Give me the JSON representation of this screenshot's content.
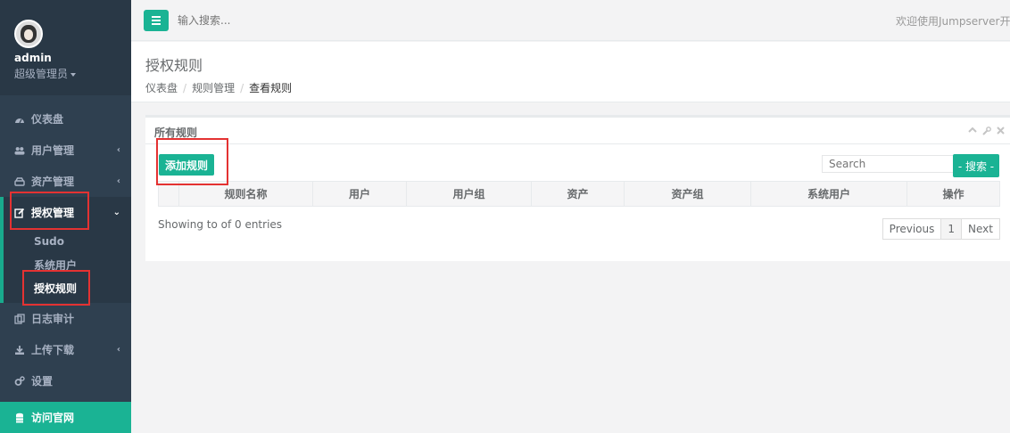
{
  "profile": {
    "name": "admin",
    "role": "超级管理员"
  },
  "nav": [
    {
      "label": "仪表盘",
      "icon": "dashboard-icon",
      "arrow": false
    },
    {
      "label": "用户管理",
      "icon": "users-icon",
      "arrow": true
    },
    {
      "label": "资产管理",
      "icon": "hdd-icon",
      "arrow": true
    },
    {
      "label": "授权管理",
      "icon": "edit-icon",
      "arrow": true,
      "active": true
    },
    {
      "label": "日志审计",
      "icon": "copy-icon",
      "arrow": false
    },
    {
      "label": "上传下载",
      "icon": "download-icon",
      "arrow": true
    },
    {
      "label": "设置",
      "icon": "gears-icon",
      "arrow": false
    },
    {
      "label": "访问官网",
      "icon": "database-icon",
      "arrow": false
    }
  ],
  "subnav": [
    {
      "label": "Sudo"
    },
    {
      "label": "系统用户"
    },
    {
      "label": "授权规则",
      "current": true
    }
  ],
  "topbar": {
    "search_placeholder": "输入搜索...",
    "welcome": "欢迎使用Jumpserver开源"
  },
  "heading": {
    "title": "授权规则",
    "breadcrumb": [
      "仪表盘",
      "规则管理",
      "查看规则"
    ]
  },
  "panel": {
    "title": "所有规则",
    "add_button": "添加规则",
    "search_placeholder": "Search",
    "search_button": "- 搜索 -",
    "columns": [
      "",
      "规则名称",
      "用户",
      "用户组",
      "资产",
      "资产组",
      "系统用户",
      "操作"
    ],
    "entries": "Showing to of 0 entries",
    "pager": {
      "prev": "Previous",
      "page": "1",
      "next": "Next"
    }
  },
  "colors": {
    "sidebar": "#2f4050",
    "accent": "#1ab394",
    "annotation": "#e43232"
  }
}
